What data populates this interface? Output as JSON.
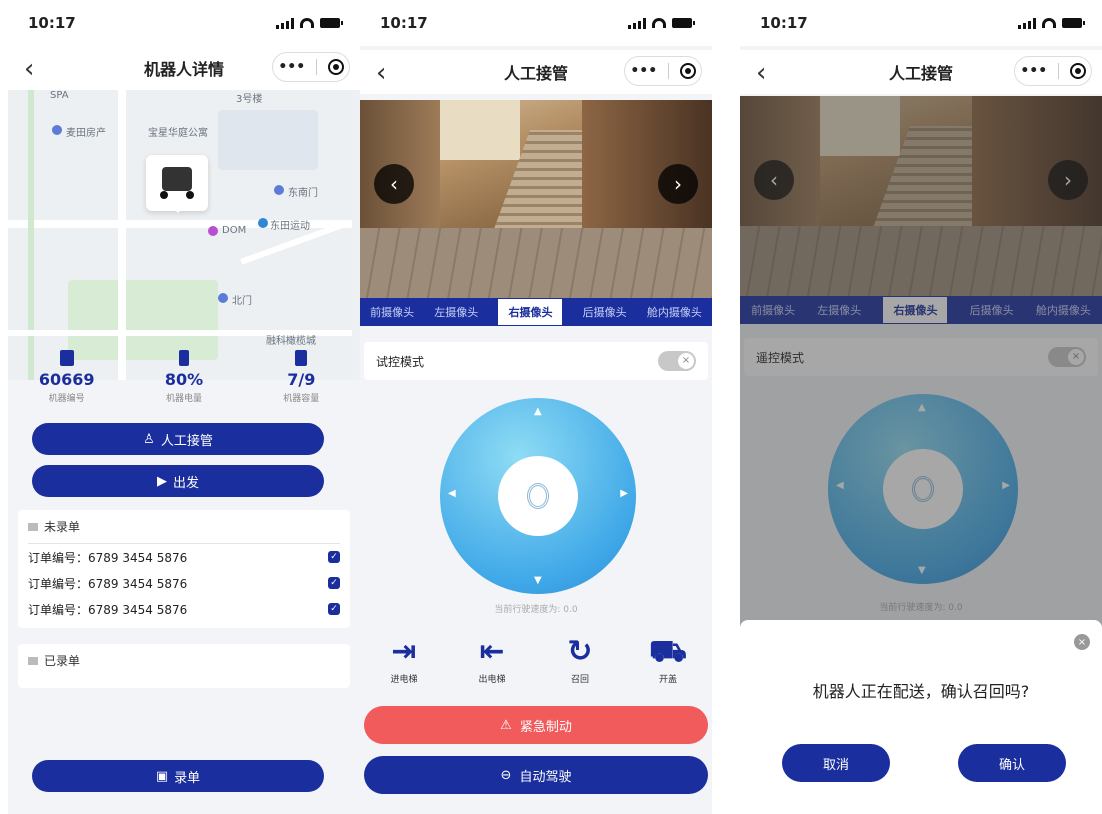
{
  "status": {
    "time": "10:17"
  },
  "screen1": {
    "title": "机器人详情",
    "map_labels": [
      "SPA",
      "3号楼",
      "麦田房产",
      "宝星华庭公寓",
      "东南门",
      "东田运动",
      "DOM",
      "北门",
      "融科橄榄城"
    ],
    "stats": [
      {
        "value": "60669",
        "label": "机器编号"
      },
      {
        "value": "80%",
        "label": "机器电量"
      },
      {
        "value": "7/9",
        "label": "机器容量"
      }
    ],
    "takeover_label": "人工接管",
    "depart_label": "出发",
    "unrecorded": {
      "title": "未录单",
      "orders": [
        "订单编号：6789 3454 5876",
        "订单编号：6789 3454 5876",
        "订单编号：6789 3454 5876"
      ]
    },
    "recorded": {
      "title": "已录单"
    },
    "record_button": "录单"
  },
  "screen2": {
    "title": "人工接管",
    "tabs": [
      "前摄像头",
      "左摄像头",
      "右摄像头",
      "后摄像头",
      "舱内摄像头"
    ],
    "active_tab": "右摄像头",
    "mode_label": "试控模式",
    "speed_text": "当前行驶速度为: 0.0",
    "actions": [
      {
        "icon": "enter-elevator-icon",
        "label": "进电梯"
      },
      {
        "icon": "exit-elevator-icon",
        "label": "出电梯"
      },
      {
        "icon": "recall-icon",
        "label": "召回"
      },
      {
        "icon": "open-lid-icon",
        "label": "开盖"
      }
    ],
    "emergency_label": "紧急制动",
    "auto_drive_label": "自动驾驶"
  },
  "screen3": {
    "title": "人工接管",
    "tabs": [
      "前摄像头",
      "左摄像头",
      "右摄像头",
      "后摄像头",
      "舱内摄像头"
    ],
    "mode_label": "遥控模式",
    "speed_text": "当前行驶速度为: 0.0",
    "dialog_message": "机器人正在配送，确认召回吗?",
    "cancel_label": "取消",
    "confirm_label": "确认"
  },
  "colors": {
    "primary": "#1a2e9e",
    "danger": "#f25b5b",
    "joystick": "#3fa8e8"
  }
}
